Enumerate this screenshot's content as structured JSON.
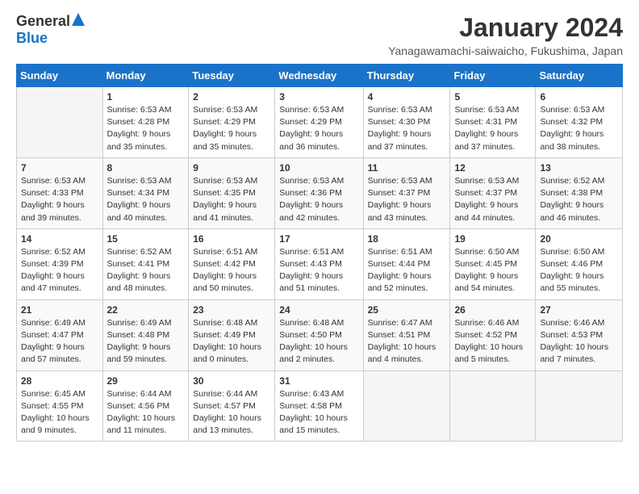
{
  "logo": {
    "general": "General",
    "blue": "Blue"
  },
  "title": "January 2024",
  "location": "Yanagawamachi-saiwaicho, Fukushima, Japan",
  "days_of_week": [
    "Sunday",
    "Monday",
    "Tuesday",
    "Wednesday",
    "Thursday",
    "Friday",
    "Saturday"
  ],
  "weeks": [
    [
      {
        "day": "",
        "info": ""
      },
      {
        "day": "1",
        "info": "Sunrise: 6:53 AM\nSunset: 4:28 PM\nDaylight: 9 hours\nand 35 minutes."
      },
      {
        "day": "2",
        "info": "Sunrise: 6:53 AM\nSunset: 4:29 PM\nDaylight: 9 hours\nand 35 minutes."
      },
      {
        "day": "3",
        "info": "Sunrise: 6:53 AM\nSunset: 4:29 PM\nDaylight: 9 hours\nand 36 minutes."
      },
      {
        "day": "4",
        "info": "Sunrise: 6:53 AM\nSunset: 4:30 PM\nDaylight: 9 hours\nand 37 minutes."
      },
      {
        "day": "5",
        "info": "Sunrise: 6:53 AM\nSunset: 4:31 PM\nDaylight: 9 hours\nand 37 minutes."
      },
      {
        "day": "6",
        "info": "Sunrise: 6:53 AM\nSunset: 4:32 PM\nDaylight: 9 hours\nand 38 minutes."
      }
    ],
    [
      {
        "day": "7",
        "info": "Sunrise: 6:53 AM\nSunset: 4:33 PM\nDaylight: 9 hours\nand 39 minutes."
      },
      {
        "day": "8",
        "info": "Sunrise: 6:53 AM\nSunset: 4:34 PM\nDaylight: 9 hours\nand 40 minutes."
      },
      {
        "day": "9",
        "info": "Sunrise: 6:53 AM\nSunset: 4:35 PM\nDaylight: 9 hours\nand 41 minutes."
      },
      {
        "day": "10",
        "info": "Sunrise: 6:53 AM\nSunset: 4:36 PM\nDaylight: 9 hours\nand 42 minutes."
      },
      {
        "day": "11",
        "info": "Sunrise: 6:53 AM\nSunset: 4:37 PM\nDaylight: 9 hours\nand 43 minutes."
      },
      {
        "day": "12",
        "info": "Sunrise: 6:53 AM\nSunset: 4:37 PM\nDaylight: 9 hours\nand 44 minutes."
      },
      {
        "day": "13",
        "info": "Sunrise: 6:52 AM\nSunset: 4:38 PM\nDaylight: 9 hours\nand 46 minutes."
      }
    ],
    [
      {
        "day": "14",
        "info": "Sunrise: 6:52 AM\nSunset: 4:39 PM\nDaylight: 9 hours\nand 47 minutes."
      },
      {
        "day": "15",
        "info": "Sunrise: 6:52 AM\nSunset: 4:41 PM\nDaylight: 9 hours\nand 48 minutes."
      },
      {
        "day": "16",
        "info": "Sunrise: 6:51 AM\nSunset: 4:42 PM\nDaylight: 9 hours\nand 50 minutes."
      },
      {
        "day": "17",
        "info": "Sunrise: 6:51 AM\nSunset: 4:43 PM\nDaylight: 9 hours\nand 51 minutes."
      },
      {
        "day": "18",
        "info": "Sunrise: 6:51 AM\nSunset: 4:44 PM\nDaylight: 9 hours\nand 52 minutes."
      },
      {
        "day": "19",
        "info": "Sunrise: 6:50 AM\nSunset: 4:45 PM\nDaylight: 9 hours\nand 54 minutes."
      },
      {
        "day": "20",
        "info": "Sunrise: 6:50 AM\nSunset: 4:46 PM\nDaylight: 9 hours\nand 55 minutes."
      }
    ],
    [
      {
        "day": "21",
        "info": "Sunrise: 6:49 AM\nSunset: 4:47 PM\nDaylight: 9 hours\nand 57 minutes."
      },
      {
        "day": "22",
        "info": "Sunrise: 6:49 AM\nSunset: 4:48 PM\nDaylight: 9 hours\nand 59 minutes."
      },
      {
        "day": "23",
        "info": "Sunrise: 6:48 AM\nSunset: 4:49 PM\nDaylight: 10 hours\nand 0 minutes."
      },
      {
        "day": "24",
        "info": "Sunrise: 6:48 AM\nSunset: 4:50 PM\nDaylight: 10 hours\nand 2 minutes."
      },
      {
        "day": "25",
        "info": "Sunrise: 6:47 AM\nSunset: 4:51 PM\nDaylight: 10 hours\nand 4 minutes."
      },
      {
        "day": "26",
        "info": "Sunrise: 6:46 AM\nSunset: 4:52 PM\nDaylight: 10 hours\nand 5 minutes."
      },
      {
        "day": "27",
        "info": "Sunrise: 6:46 AM\nSunset: 4:53 PM\nDaylight: 10 hours\nand 7 minutes."
      }
    ],
    [
      {
        "day": "28",
        "info": "Sunrise: 6:45 AM\nSunset: 4:55 PM\nDaylight: 10 hours\nand 9 minutes."
      },
      {
        "day": "29",
        "info": "Sunrise: 6:44 AM\nSunset: 4:56 PM\nDaylight: 10 hours\nand 11 minutes."
      },
      {
        "day": "30",
        "info": "Sunrise: 6:44 AM\nSunset: 4:57 PM\nDaylight: 10 hours\nand 13 minutes."
      },
      {
        "day": "31",
        "info": "Sunrise: 6:43 AM\nSunset: 4:58 PM\nDaylight: 10 hours\nand 15 minutes."
      },
      {
        "day": "",
        "info": ""
      },
      {
        "day": "",
        "info": ""
      },
      {
        "day": "",
        "info": ""
      }
    ]
  ]
}
